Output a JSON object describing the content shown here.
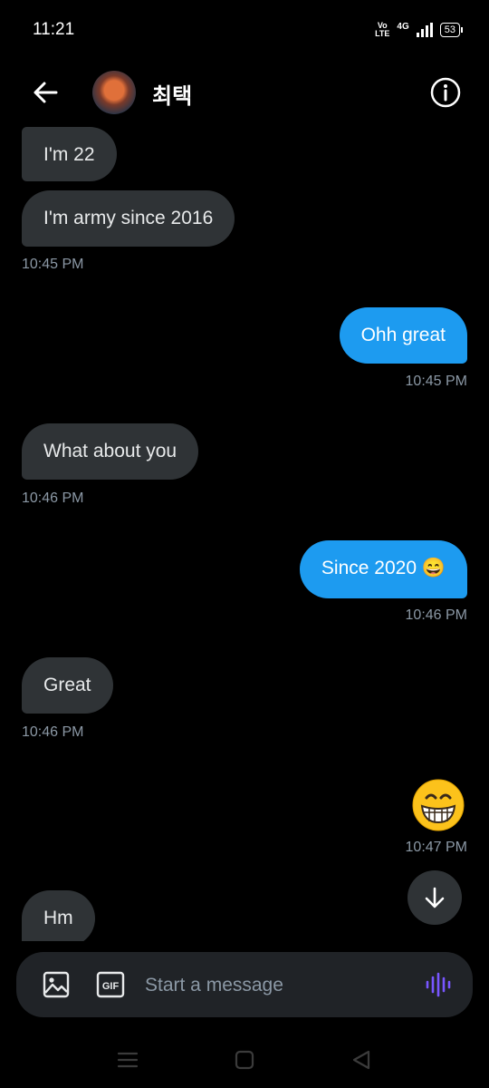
{
  "status": {
    "time": "11:21",
    "network_badge": "Vo\nLTE",
    "network_type": "4G",
    "battery": "53"
  },
  "header": {
    "contact_name": "최택",
    "back_icon": "back-arrow-icon",
    "info_icon": "info-icon"
  },
  "messages": [
    {
      "side": "received",
      "text": "I'm 22"
    },
    {
      "side": "received",
      "text": "I'm army since 2016",
      "time": "10:45 PM"
    },
    {
      "side": "sent",
      "text": "Ohh great",
      "time": "10:45 PM"
    },
    {
      "side": "received",
      "text": "What about you",
      "time": "10:46 PM"
    },
    {
      "side": "sent",
      "text": "Since 2020 😄",
      "time": "10:46 PM"
    },
    {
      "side": "received",
      "text": "Great",
      "time": "10:46 PM"
    },
    {
      "side": "sent",
      "emoji": "grinning-face",
      "time": "10:47 PM"
    },
    {
      "side": "received",
      "text": "Hm"
    }
  ],
  "composer": {
    "placeholder": "Start a message",
    "image_icon": "image-icon",
    "gif_label": "GIF",
    "voice_icon": "voice-waveform-icon"
  },
  "colors": {
    "sent_bubble": "#1d9bf0",
    "received_bubble": "#2f3336",
    "background": "#000000",
    "accent_voice": "#7856ff"
  }
}
